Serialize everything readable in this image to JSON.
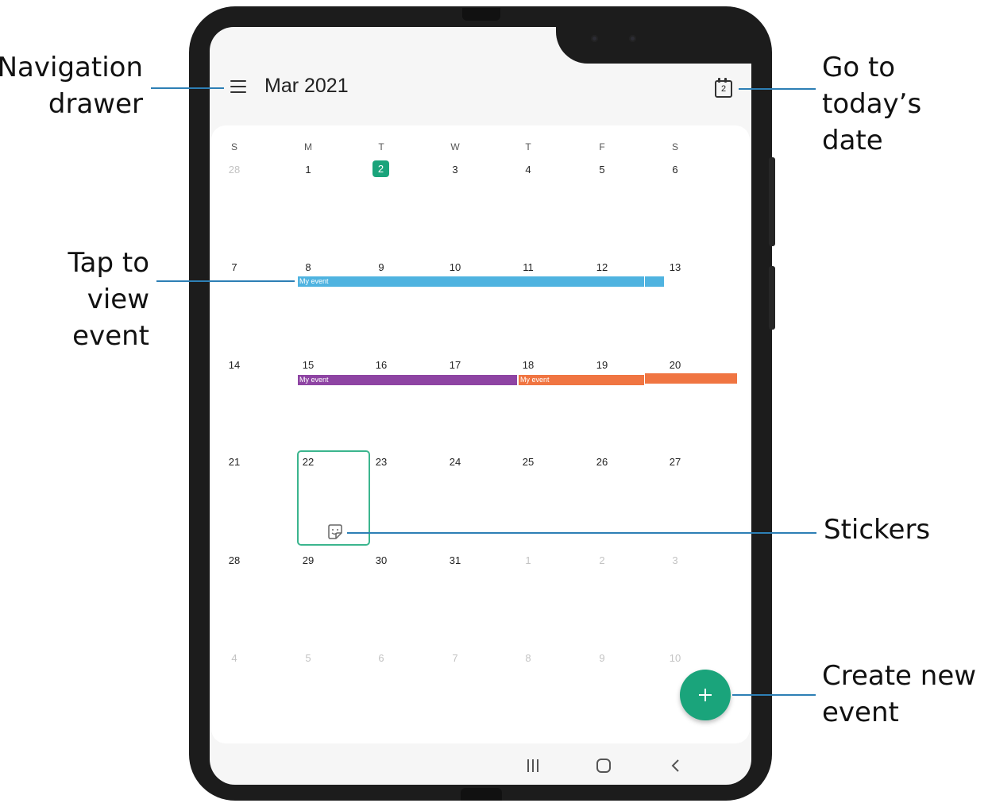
{
  "callouts": {
    "navigation_drawer": [
      "Navigation",
      "drawer"
    ],
    "tap_to_view_event": [
      "Tap to view",
      "event"
    ],
    "go_to_today": [
      "Go to today’s",
      "date"
    ],
    "stickers": "Stickers",
    "create_new_event": [
      "Create new",
      "event"
    ]
  },
  "app_bar": {
    "menu_icon": "hamburger-menu-icon",
    "month_title": "Mar 2021",
    "today_icon": "calendar-today-icon",
    "today_icon_number": "2"
  },
  "weekdays": [
    "S",
    "M",
    "T",
    "W",
    "T",
    "F",
    "S"
  ],
  "weeks": [
    [
      "28",
      "1",
      "2",
      "3",
      "4",
      "5",
      "6"
    ],
    [
      "7",
      "8",
      "9",
      "10",
      "11",
      "12",
      "13"
    ],
    [
      "14",
      "15",
      "16",
      "17",
      "18",
      "19",
      "20"
    ],
    [
      "21",
      "22",
      "23",
      "24",
      "25",
      "26",
      "27"
    ],
    [
      "28",
      "29",
      "30",
      "31",
      "1",
      "2",
      "3"
    ],
    [
      "4",
      "5",
      "6",
      "7",
      "8",
      "9",
      "10"
    ]
  ],
  "today": "2",
  "selected_day": "22",
  "events": [
    {
      "label": "My event",
      "color": "#4fb3e0"
    },
    {
      "label": "My event",
      "color": "#8e44a3"
    },
    {
      "label": "My event",
      "color": "#f07542"
    }
  ],
  "sticker_icon": "sticker-icon",
  "fab_icon": "plus-icon",
  "nav_bar": [
    "recent-apps-icon",
    "home-icon",
    "back-icon"
  ],
  "colors": {
    "accent": "#1aa47b",
    "callout_line": "#2d7fb5"
  }
}
